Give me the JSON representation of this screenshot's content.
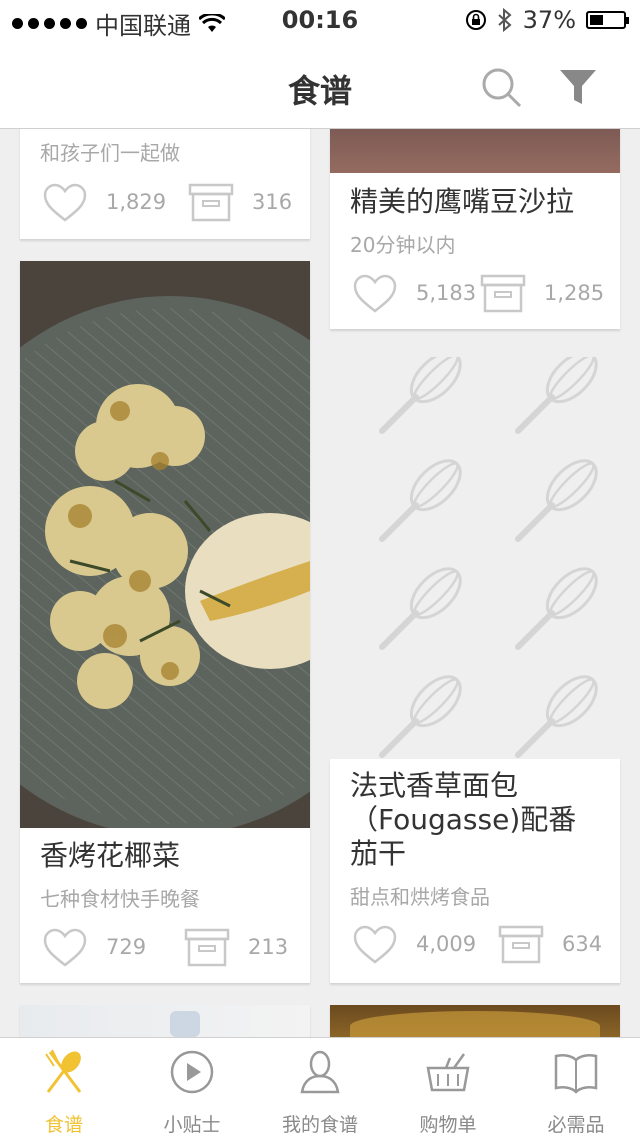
{
  "status_bar": {
    "carrier": "中国联通",
    "time": "00:16",
    "battery": "37%"
  },
  "navbar": {
    "title": "食谱"
  },
  "recipes": [
    {
      "title": "",
      "subtitle": "和孩子们一起做",
      "likes": "1,829",
      "saves": "316"
    },
    {
      "title": "精美的鹰嘴豆沙拉",
      "subtitle": "20分钟以内",
      "likes": "5,183",
      "saves": "1,285"
    },
    {
      "title": "香烤花椰菜",
      "subtitle": "七种食材快手晚餐",
      "likes": "729",
      "saves": "213"
    },
    {
      "title": "法式香草面包\n（Fougasse)配番\n茄干",
      "subtitle": "甜点和烘烤食品",
      "likes": "4,009",
      "saves": "634"
    }
  ],
  "tabs": [
    {
      "label": "食谱",
      "icon": "spoon-fork-icon",
      "active": true
    },
    {
      "label": "小贴士",
      "icon": "play-icon",
      "active": false
    },
    {
      "label": "我的食谱",
      "icon": "profile-icon",
      "active": false
    },
    {
      "label": "购物单",
      "icon": "basket-icon",
      "active": false
    },
    {
      "label": "必需品",
      "icon": "book-icon",
      "active": false
    }
  ],
  "colors": {
    "accent": "#f1c232",
    "background": "#efefef"
  }
}
